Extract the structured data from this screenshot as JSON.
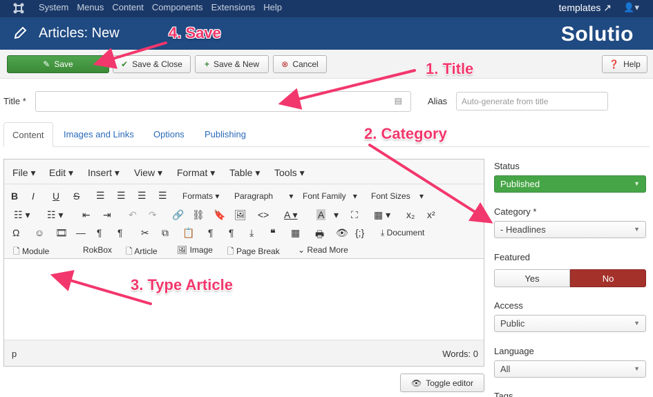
{
  "topnav": {
    "items": [
      "System",
      "Menus",
      "Content",
      "Components",
      "Extensions",
      "Help"
    ],
    "site_link": "templates",
    "user_icon": "user-icon"
  },
  "header": {
    "title": "Articles: New",
    "logo": "Solutio"
  },
  "toolbar": {
    "save": "Save",
    "save_close": "Save & Close",
    "save_new": "Save & New",
    "cancel": "Cancel",
    "help": "Help"
  },
  "form": {
    "title_label": "Title *",
    "title_value": "",
    "alias_label": "Alias",
    "alias_placeholder": "Auto-generate from title"
  },
  "tabs": [
    "Content",
    "Images and Links",
    "Options",
    "Publishing"
  ],
  "editor": {
    "menus": [
      "File",
      "Edit",
      "Insert",
      "View",
      "Format",
      "Table",
      "Tools"
    ],
    "formats": "Formats",
    "block": "Paragraph",
    "font_family": "Font Family",
    "font_sizes": "Font Sizes",
    "document": "Document",
    "row4": [
      "Module",
      "RokBox",
      "Article",
      "Image",
      "Page Break",
      "Read More"
    ],
    "path": "p",
    "words": "Words: 0",
    "toggle": "Toggle editor"
  },
  "sidebar": {
    "status_label": "Status",
    "status_value": "Published",
    "category_label": "Category *",
    "category_value": "- Headlines",
    "featured_label": "Featured",
    "featured_yes": "Yes",
    "featured_no": "No",
    "access_label": "Access",
    "access_value": "Public",
    "language_label": "Language",
    "language_value": "All",
    "tags_label": "Tags"
  },
  "annotations": {
    "a1": "1. Title",
    "a2": "2. Category",
    "a3": "3. Type Article",
    "a4": "4. Save"
  },
  "colors": {
    "nav": "#1a3867",
    "header": "#1f4a82",
    "save_green": "#46a546",
    "no_red": "#a5312b",
    "annotation_pink": "#f2376c"
  }
}
